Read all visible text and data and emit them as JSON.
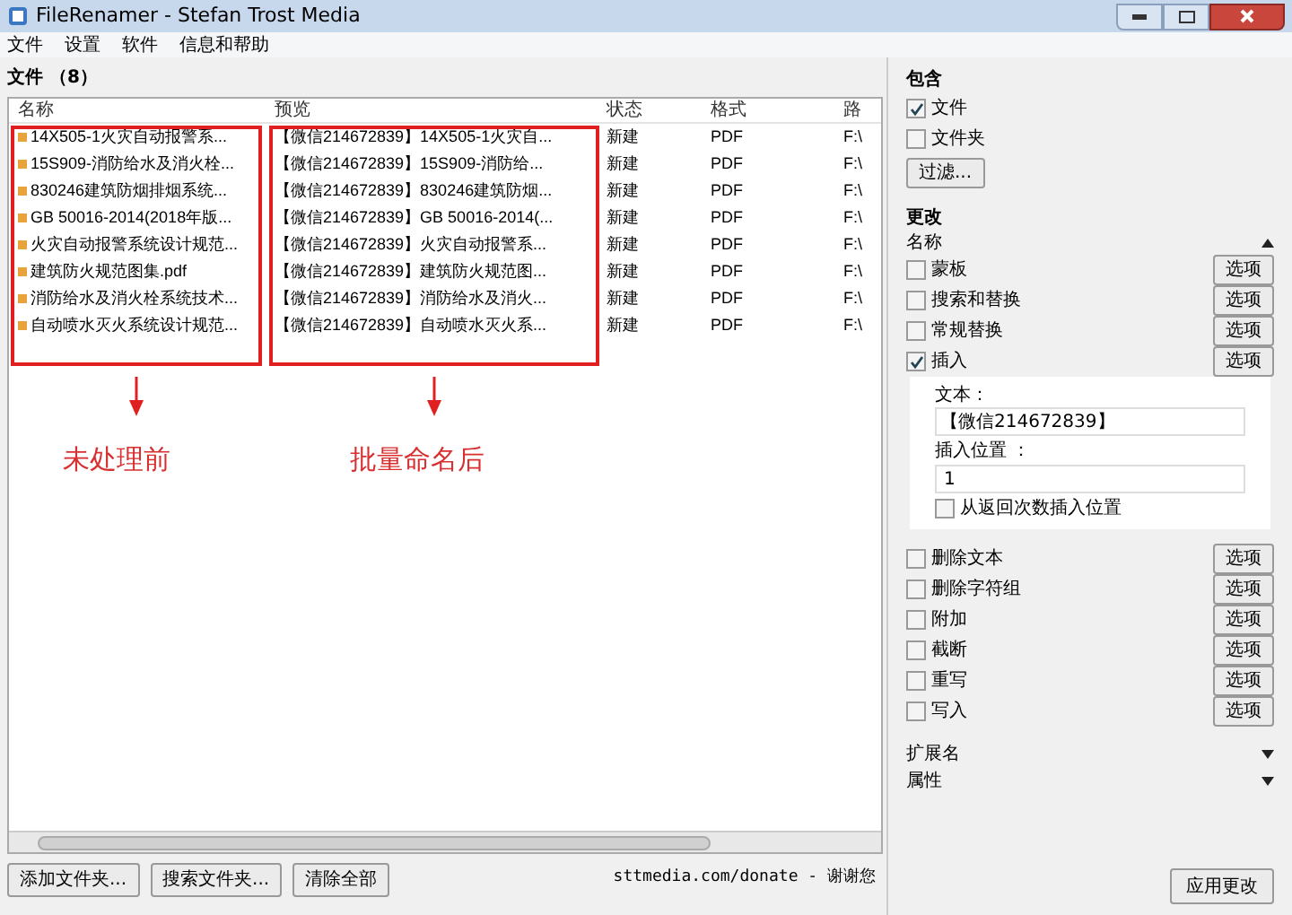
{
  "window": {
    "title": "FileRenamer - Stefan Trost Media"
  },
  "menu": [
    "文件",
    "设置",
    "软件",
    "信息和帮助"
  ],
  "files_heading": "文件 （8）",
  "table": {
    "columns": [
      "名称",
      "预览",
      "状态",
      "格式",
      "路"
    ],
    "rows": [
      {
        "cells": [
          "14X505-1火灾自动报警系...",
          "【微信214672839】14X505-1火灾自...",
          "新建",
          "PDF",
          "F:\\"
        ]
      },
      {
        "cells": [
          "15S909-消防给水及消火栓...",
          "【微信214672839】15S909-消防给...",
          "新建",
          "PDF",
          "F:\\"
        ]
      },
      {
        "cells": [
          "830246建筑防烟排烟系统...",
          "【微信214672839】830246建筑防烟...",
          "新建",
          "PDF",
          "F:\\"
        ]
      },
      {
        "cells": [
          "GB 50016-2014(2018年版...",
          "【微信214672839】GB 50016-2014(...",
          "新建",
          "PDF",
          "F:\\"
        ]
      },
      {
        "cells": [
          "火灾自动报警系统设计规范...",
          "【微信214672839】火灾自动报警系...",
          "新建",
          "PDF",
          "F:\\"
        ]
      },
      {
        "cells": [
          "建筑防火规范图集.pdf",
          "【微信214672839】建筑防火规范图...",
          "新建",
          "PDF",
          "F:\\"
        ]
      },
      {
        "cells": [
          "消防给水及消火栓系统技术...",
          "【微信214672839】消防给水及消火...",
          "新建",
          "PDF",
          "F:\\"
        ]
      },
      {
        "cells": [
          "自动喷水灭火系统设计规范...",
          "【微信214672839】自动喷水灭火系...",
          "新建",
          "PDF",
          "F:\\"
        ]
      }
    ]
  },
  "annotations": [
    {
      "label": "未处理前"
    },
    {
      "label": "批量命名后"
    }
  ],
  "bottom_buttons": [
    "添加文件夹...",
    "搜索文件夹...",
    "清除全部"
  ],
  "donate": "sttmedia.com/donate - 谢谢您",
  "include": {
    "title": "包含",
    "options": [
      {
        "label": "文件",
        "checked": true
      },
      {
        "label": "文件夹",
        "checked": false
      }
    ],
    "filter_button": "过滤..."
  },
  "change": {
    "title": "更改",
    "section": "名称",
    "options_before": [
      {
        "label": "蒙板",
        "checked": false,
        "button": "选项"
      },
      {
        "label": "搜索和替换",
        "checked": false,
        "button": "选项"
      },
      {
        "label": "常规替换",
        "checked": false,
        "button": "选项"
      },
      {
        "label": "插入",
        "checked": true,
        "button": "选项"
      }
    ],
    "insert": {
      "text_label": "文本：",
      "text_value": "【微信214672839】",
      "position_label": "插入位置 ：",
      "position_value": "1",
      "reverse": {
        "label": "从返回次数插入位置",
        "checked": false
      }
    },
    "options_after": [
      {
        "label": "删除文本",
        "checked": false,
        "button": "选项"
      },
      {
        "label": "删除字符组",
        "checked": false,
        "button": "选项"
      },
      {
        "label": "附加",
        "checked": false,
        "button": "选项"
      },
      {
        "label": "截断",
        "checked": false,
        "button": "选项"
      },
      {
        "label": "重写",
        "checked": false,
        "button": "选项"
      },
      {
        "label": "写入",
        "checked": false,
        "button": "选项"
      }
    ],
    "collapsed_sections": [
      "扩展名",
      "属性"
    ]
  },
  "apply_button": "应用更改"
}
